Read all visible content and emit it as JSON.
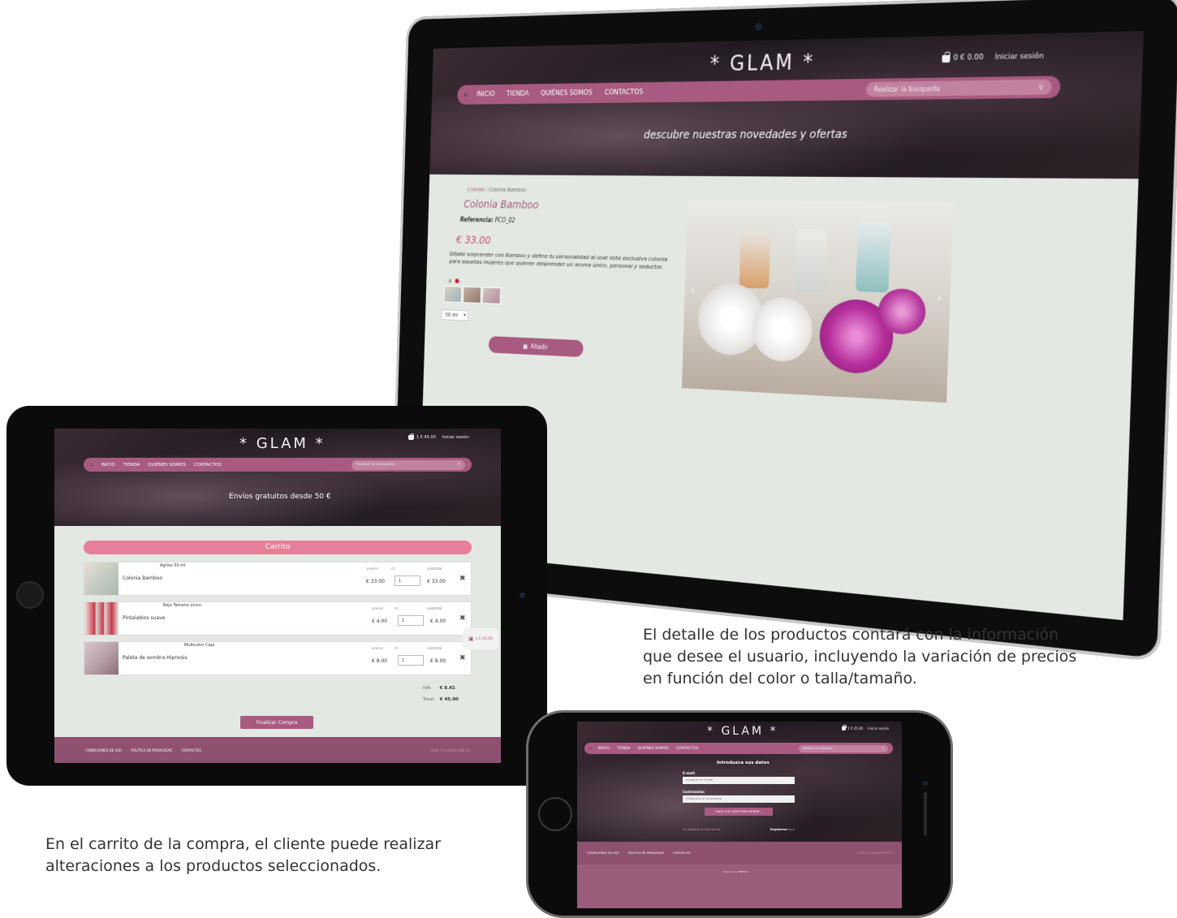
{
  "site": {
    "logo": "* GLAM *",
    "cart_large": "0  € 0.00",
    "cart_small": "1  € 45.00",
    "login": "Iniciar sesión",
    "nav": {
      "home_icon": "home-icon",
      "items": [
        "INICIO",
        "TIENDA",
        "QUIÉNES SOMOS",
        "CONTACTOS"
      ],
      "search_placeholder": "Realizar la búsqueda"
    },
    "footer": {
      "links": [
        "CONDICIONES DE USO",
        "POLÍTICA DE PRIVACIDAD",
        "CONTACTOS"
      ],
      "copy": "2018 © Lujalitte PHE.CS"
    },
    "colors": {
      "brand": "#a85a80",
      "footer": "#8e5270",
      "cart_title": "#e67f98",
      "price": "#d05070",
      "content_bg": "#e3e8e2"
    }
  },
  "surface": {
    "hero_text": "descubre nuestras novedades y ofertas",
    "breadcrumb": [
      "Colonia",
      "Colonia Bamboo"
    ],
    "product_title": "Colonia Bamboo",
    "reference_label": "Referencia:",
    "reference_value": "PCO_02",
    "price": "€ 33.00",
    "description": "Déjate sorprender con Bamboo y define tu personalidad al usar esta exclusiva colonia para aquellas mujeres que quieren desprender un aroma único, personal y seductor.",
    "color_label": "0",
    "size_option": "50 ml",
    "add_button": "Añadir"
  },
  "ipad": {
    "hero_text": "Envíos gratuitos desde 50 €",
    "cart_title": "Carrito",
    "col_price": "precio",
    "col_qty": "ct.",
    "col_subtotal": "subtotal",
    "rows": [
      {
        "variant": "Agrios 50 ml",
        "name": "Colonia Bamboo",
        "price": "€ 33.00",
        "qty": "1",
        "subtotal": "€ 33.00"
      },
      {
        "variant": "Rojo Tamaño único",
        "name": "Pintalabios suave",
        "price": "€ 4.00",
        "qty": "1",
        "subtotal": "€ 4.00"
      },
      {
        "variant": "Multicolor Caja",
        "name": "Paleta de sombra Hipnosis",
        "price": "€ 8.00",
        "qty": "1",
        "subtotal": "€ 8.00"
      }
    ],
    "iva_label": "IVA:",
    "iva_value": "€ 8.41",
    "total_label": "Total:",
    "total_value": "€ 45.00",
    "checkout_button": "Finalizar Compra",
    "side_cart": "1  € 45.00"
  },
  "iphone": {
    "login_title": "Introduzca sus datos",
    "email_label": "E-mail:",
    "email_placeholder": "Introducir el E-mail",
    "password_label": "Contraseña:",
    "password_placeholder": "Introduzca la Contraseña",
    "submit_button": "HAGA CLIC AQUÍ PARA ENTRAR...",
    "forgot": "He olvidado la Contraseña",
    "register_label": "Regístrese",
    "register_link": "aquí",
    "powered_by": "Powered by",
    "powered_brand": "PHE.CS"
  },
  "captions": {
    "detail": "El detalle de los productos contará con la información que desee el usuario, incluyendo la variación de precios en función del color o talla/tamaño.",
    "cart": "En el carrito de la compra, el cliente puede realizar alteraciones a los productos seleccionados."
  }
}
